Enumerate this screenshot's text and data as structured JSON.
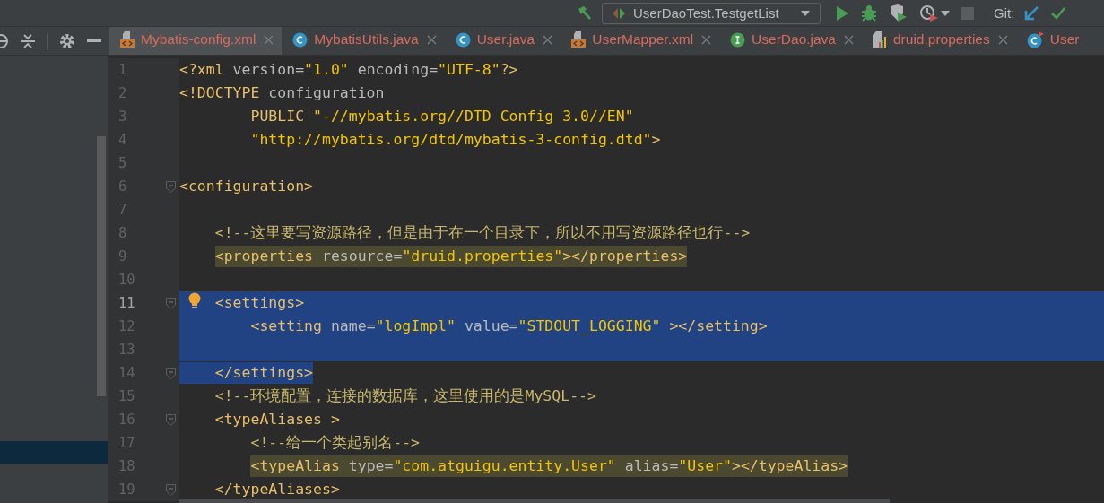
{
  "toolbar": {
    "run_configuration": "UserDaoTest.TestgetList",
    "git_label": "Git:"
  },
  "tabs": [
    {
      "label": "Mybatis-config.xml",
      "kind": "xml",
      "selected": true
    },
    {
      "label": "MybatisUtils.java",
      "kind": "class",
      "selected": false
    },
    {
      "label": "User.java",
      "kind": "class",
      "selected": false
    },
    {
      "label": "UserMapper.xml",
      "kind": "xml",
      "selected": false
    },
    {
      "label": "UserDao.java",
      "kind": "interface",
      "selected": false
    },
    {
      "label": "druid.properties",
      "kind": "properties",
      "selected": false
    },
    {
      "label": "User",
      "kind": "test",
      "selected": false
    }
  ],
  "editor": {
    "lines": [
      {
        "number": "1",
        "segments": [
          {
            "kind": "tag",
            "text": "<?xml "
          },
          {
            "kind": "attr",
            "text": "version="
          },
          {
            "kind": "string",
            "text": "\"1.0\""
          },
          {
            "kind": "attr",
            "text": " encoding="
          },
          {
            "kind": "string",
            "text": "\"UTF-8\""
          },
          {
            "kind": "tag",
            "text": "?>"
          }
        ],
        "selected": false,
        "highlighted": false,
        "current": false,
        "fold": false,
        "bulb": false
      },
      {
        "number": "2",
        "segments": [
          {
            "kind": "tag",
            "text": "<!DOCTYPE"
          },
          {
            "kind": "attr",
            "text": " configuration"
          }
        ],
        "selected": false,
        "highlighted": false,
        "current": false,
        "fold": false,
        "bulb": false
      },
      {
        "number": "3",
        "segments": [
          {
            "kind": "tag",
            "text": "        PUBLIC "
          },
          {
            "kind": "string",
            "text": "\"-//mybatis.org//DTD Config 3.0//EN\""
          }
        ],
        "selected": false,
        "highlighted": false,
        "current": false,
        "fold": false,
        "bulb": false
      },
      {
        "number": "4",
        "segments": [
          {
            "kind": "string",
            "text": "        \"http://mybatis.org/dtd/mybatis-3-config.dtd\""
          },
          {
            "kind": "tag",
            "text": ">"
          }
        ],
        "selected": false,
        "highlighted": false,
        "current": false,
        "fold": false,
        "bulb": false
      },
      {
        "number": "5",
        "selected": false,
        "highlighted": false,
        "current": false,
        "fold": false,
        "bulb": false
      },
      {
        "number": "6",
        "segments": [
          {
            "kind": "tag",
            "text": "<configuration>"
          }
        ],
        "selected": false,
        "highlighted": false,
        "current": false,
        "fold": true,
        "bulb": false
      },
      {
        "number": "7",
        "selected": false,
        "highlighted": false,
        "current": false,
        "fold": false,
        "bulb": false
      },
      {
        "number": "8",
        "segments": [
          {
            "kind": "comment",
            "text": "    <!--这里要写资源路径，但是由于在一个目录下，所以不用写资源路径也行-->"
          }
        ],
        "selected": false,
        "highlighted": false,
        "current": false,
        "fold": false,
        "bulb": false
      },
      {
        "number": "9",
        "segments": [
          {
            "kind": "tag",
            "text": "    <properties "
          },
          {
            "kind": "attr",
            "text": "resource="
          },
          {
            "kind": "string",
            "text": "\"druid.properties\""
          },
          {
            "kind": "tag",
            "text": "></properties>"
          }
        ],
        "selected": false,
        "highlighted": true,
        "current": false,
        "fold": false,
        "bulb": false
      },
      {
        "number": "10",
        "selected": false,
        "highlighted": false,
        "current": false,
        "fold": false,
        "bulb": false
      },
      {
        "number": "11",
        "segments": [
          {
            "kind": "tag",
            "text": "    <settings>"
          }
        ],
        "selected": true,
        "highlighted": false,
        "current": true,
        "fold": true,
        "bulb": true
      },
      {
        "number": "12",
        "segments": [
          {
            "kind": "tag",
            "text": "        <setting "
          },
          {
            "kind": "attr",
            "text": "name="
          },
          {
            "kind": "string",
            "text": "\"logImpl\""
          },
          {
            "kind": "attr",
            "text": " value="
          },
          {
            "kind": "string",
            "text": "\"STDOUT_LOGGING\""
          },
          {
            "kind": "tag",
            "text": " ></setting>"
          }
        ],
        "selected": true,
        "highlighted": false,
        "current": false,
        "fold": false,
        "bulb": false
      },
      {
        "number": "13",
        "selected": true,
        "highlighted": false,
        "current": false,
        "fold": false,
        "bulb": false
      },
      {
        "number": "14",
        "segments": [
          {
            "kind": "tag",
            "text": "    </settings>"
          }
        ],
        "selected": true,
        "highlighted": false,
        "current": false,
        "fold": true,
        "bulb": false
      },
      {
        "number": "15",
        "segments": [
          {
            "kind": "comment",
            "text": "    <!--环境配置，连接的数据库，这里使用的是MySQL-->"
          }
        ],
        "selected": false,
        "highlighted": false,
        "current": false,
        "fold": false,
        "bulb": false
      },
      {
        "number": "16",
        "segments": [
          {
            "kind": "tag",
            "text": "    <typeAliases >"
          }
        ],
        "selected": false,
        "highlighted": false,
        "current": false,
        "fold": true,
        "bulb": false
      },
      {
        "number": "17",
        "segments": [
          {
            "kind": "comment",
            "text": "        <!--给一个类起别名-->"
          }
        ],
        "selected": false,
        "highlighted": false,
        "current": false,
        "fold": false,
        "bulb": false
      },
      {
        "number": "18",
        "segments": [
          {
            "kind": "tag",
            "text": "        <typeAlias "
          },
          {
            "kind": "attr",
            "text": "type="
          },
          {
            "kind": "string",
            "text": "\"com.atguigu.entity.User\""
          },
          {
            "kind": "attr",
            "text": " alias="
          },
          {
            "kind": "string",
            "text": "\"User\""
          },
          {
            "kind": "tag",
            "text": "></typeAlias>"
          }
        ],
        "selected": false,
        "highlighted": true,
        "current": false,
        "fold": false,
        "bulb": false
      },
      {
        "number": "19",
        "segments": [
          {
            "kind": "tag",
            "text": "    </typeAliases>"
          }
        ],
        "selected": false,
        "highlighted": false,
        "current": false,
        "fold": true,
        "bulb": false
      }
    ]
  }
}
